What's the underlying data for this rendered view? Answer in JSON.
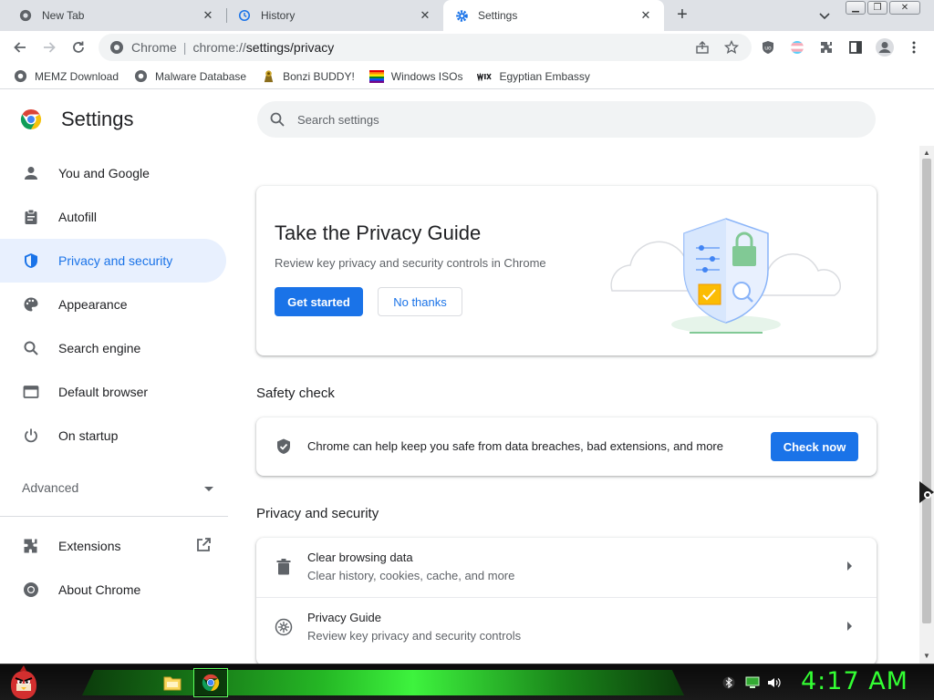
{
  "tabs": [
    {
      "label": "New Tab",
      "icon": "chrome-icon",
      "active": false
    },
    {
      "label": "History",
      "icon": "history-icon",
      "active": false
    },
    {
      "label": "Settings",
      "icon": "gear-icon",
      "active": true
    }
  ],
  "toolbar": {
    "chip": "Chrome",
    "url_scheme": "chrome://",
    "url_path": "settings/privacy"
  },
  "bookmarks": [
    {
      "label": "MEMZ Download",
      "icon": "globe-icon"
    },
    {
      "label": "Malware Database",
      "icon": "globe-icon"
    },
    {
      "label": "Bonzi BUDDY!",
      "icon": "bonzi-icon"
    },
    {
      "label": "Windows ISOs",
      "icon": "rainbow-flag-icon"
    },
    {
      "label": "Egyptian Embassy",
      "icon": "wix-icon"
    }
  ],
  "settings": {
    "title": "Settings",
    "search_placeholder": "Search settings"
  },
  "nav": {
    "items": [
      {
        "label": "You and Google",
        "icon": "person-icon"
      },
      {
        "label": "Autofill",
        "icon": "clipboard-icon"
      },
      {
        "label": "Privacy and security",
        "icon": "shield-icon",
        "active": true
      },
      {
        "label": "Appearance",
        "icon": "palette-icon"
      },
      {
        "label": "Search engine",
        "icon": "search-icon"
      },
      {
        "label": "Default browser",
        "icon": "browser-icon"
      },
      {
        "label": "On startup",
        "icon": "power-icon"
      }
    ],
    "advanced": "Advanced",
    "extensions": "Extensions",
    "about": "About Chrome"
  },
  "guide": {
    "title": "Take the Privacy Guide",
    "description": "Review key privacy and security controls in Chrome",
    "get_started": "Get started",
    "no_thanks": "No thanks"
  },
  "safety": {
    "section_title": "Safety check",
    "text": "Chrome can help keep you safe from data breaches, bad extensions, and more",
    "button": "Check now"
  },
  "privacy": {
    "section_title": "Privacy and security",
    "rows": [
      {
        "title": "Clear browsing data",
        "subtitle": "Clear history, cookies, cache, and more",
        "icon": "trash-icon"
      },
      {
        "title": "Privacy Guide",
        "subtitle": "Review key privacy and security controls",
        "icon": "compass-icon"
      }
    ]
  },
  "taskbar": {
    "clock": "4:17 AM"
  },
  "colors": {
    "accent": "#1a73e8",
    "nav_active_bg": "#e8f0fe",
    "clock_green": "#33ff33"
  }
}
